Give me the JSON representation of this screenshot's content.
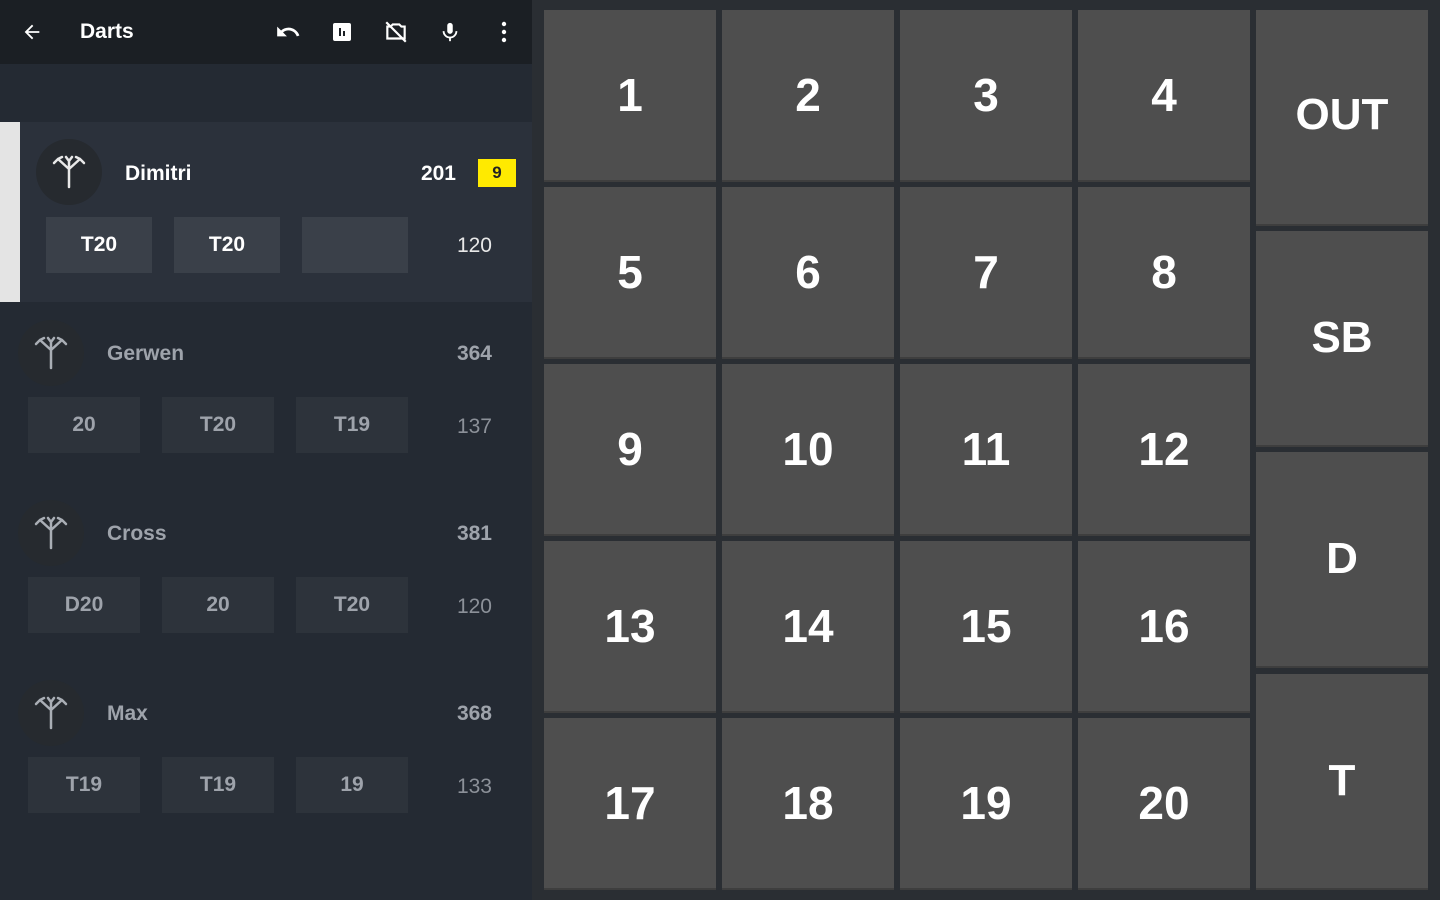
{
  "appbar": {
    "title": "Darts",
    "icons": [
      "back-arrow-icon",
      "undo-icon",
      "scoreboard-icon",
      "no-camera-icon",
      "microphone-icon",
      "more-vert-icon"
    ]
  },
  "players": [
    {
      "name": "Dimitri",
      "score": "201",
      "badge": "9",
      "darts": [
        "T20",
        "T20",
        ""
      ],
      "round_total": "120",
      "active": true
    },
    {
      "name": "Gerwen",
      "score": "364",
      "darts": [
        "20",
        "T20",
        "T19"
      ],
      "round_total": "137",
      "active": false
    },
    {
      "name": "Cross",
      "score": "381",
      "darts": [
        "D20",
        "20",
        "T20"
      ],
      "round_total": "120",
      "active": false
    },
    {
      "name": "Max",
      "score": "368",
      "darts": [
        "T19",
        "T19",
        "19"
      ],
      "round_total": "133",
      "active": false
    }
  ],
  "keypad": {
    "numbers": [
      "1",
      "2",
      "3",
      "4",
      "5",
      "6",
      "7",
      "8",
      "9",
      "10",
      "11",
      "12",
      "13",
      "14",
      "15",
      "16",
      "17",
      "18",
      "19",
      "20"
    ],
    "side_keys": [
      "OUT",
      "SB",
      "D",
      "T"
    ]
  },
  "colors": {
    "badge": "#ffea00",
    "key": "#4e4e4e",
    "panel": "#242a33"
  }
}
